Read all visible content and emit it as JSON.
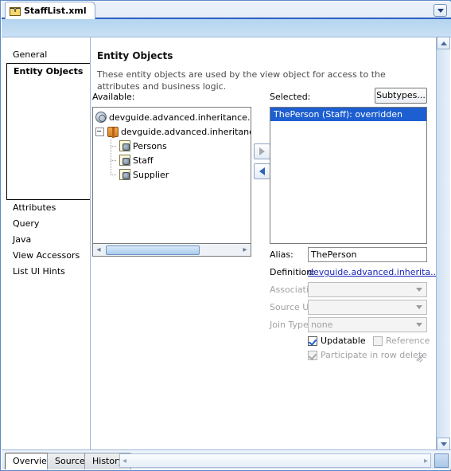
{
  "window": {
    "document_tab": {
      "label": "StaffList.xml",
      "icon": "xml-file-icon"
    },
    "tab_menu_icon": "chevron-down-icon",
    "help_icon": "?"
  },
  "nav": {
    "items": [
      {
        "label": "General",
        "selected": false
      },
      {
        "label": "Entity Objects",
        "selected": true
      },
      {
        "label": "Attributes",
        "selected": false
      },
      {
        "label": "Query",
        "selected": false
      },
      {
        "label": "Java",
        "selected": false
      },
      {
        "label": "View Accessors",
        "selected": false
      },
      {
        "label": "List UI Hints",
        "selected": false
      }
    ]
  },
  "page": {
    "title": "Entity Objects",
    "description": "These entity objects are used by the view object for access to the attributes and business logic."
  },
  "available": {
    "caption": "Available:",
    "tree": [
      {
        "label": "devguide.advanced.inheritance.Inhe",
        "icon": "globe-icon",
        "level": 0
      },
      {
        "label": "devguide.advanced.inheritance",
        "icon": "package-icon",
        "level": 0,
        "expander": "minus"
      },
      {
        "label": "Persons",
        "icon": "entity-object-icon",
        "level": 1
      },
      {
        "label": "Staff",
        "icon": "entity-object-icon",
        "level": 1
      },
      {
        "label": "Supplier",
        "icon": "entity-object-icon",
        "level": 1
      }
    ],
    "scrollbar": {
      "left_arrow": "◂",
      "right_arrow": "▸"
    }
  },
  "transfer": {
    "add_icon": "arrow-right-icon",
    "remove_icon": "arrow-left-icon"
  },
  "selected_panel": {
    "caption": "Selected:",
    "subtypes_button": "Subtypes...",
    "items": [
      {
        "label": "ThePerson (Staff): overridden",
        "selected": true
      }
    ]
  },
  "form": {
    "alias": {
      "label": "Alias:",
      "value": "ThePerson",
      "enabled": true
    },
    "definition": {
      "label": "Definition:",
      "value": "devguide.advanced.inherita...",
      "is_link": true
    },
    "association": {
      "label": "Association:",
      "value": "",
      "enabled": false
    },
    "source_usage": {
      "label": "Source Usage:",
      "value": "",
      "enabled": false
    },
    "join_type": {
      "label": "Join Type:",
      "value": "none",
      "enabled": false
    },
    "checkboxes": [
      {
        "label": "Updatable",
        "checked": true,
        "enabled": true
      },
      {
        "label": "Reference",
        "checked": false,
        "enabled": false
      },
      {
        "label": "Participate in row delete",
        "checked": true,
        "enabled": false
      }
    ]
  },
  "bottom": {
    "tabs": [
      {
        "label": "Overview",
        "active": true
      },
      {
        "label": "Source",
        "active": false
      },
      {
        "label": "History",
        "active": false
      }
    ],
    "scroll_left_icon": "◂",
    "scroll_right_icon": "▸"
  },
  "colors": {
    "accent_blue": "#2f5fc4",
    "selection_blue": "#1d5fd0",
    "link_blue": "#1a23b8",
    "band_blue": "#b4d4ee",
    "disabled_gray": "#a2a2a2"
  }
}
